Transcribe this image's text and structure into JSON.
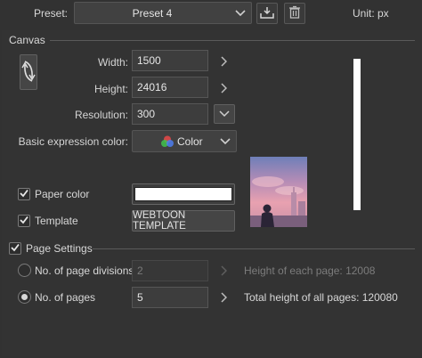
{
  "top": {
    "preset_label": "Preset:",
    "preset_value": "Preset 4",
    "unit_label": "Unit: px"
  },
  "canvas": {
    "section_title": "Canvas",
    "width_label": "Width:",
    "width_value": "1500",
    "height_label": "Height:",
    "height_value": "24016",
    "resolution_label": "Resolution:",
    "resolution_value": "300",
    "color_label": "Basic expression color:",
    "color_value": "Color",
    "paper_color_label": "Paper color",
    "paper_color_checked": true,
    "paper_color_swatch": "#ffffff",
    "template_label": "Template",
    "template_checked": true,
    "template_value": "WEBTOON TEMPLATE"
  },
  "page_settings": {
    "section_title": "Page Settings",
    "checked": true,
    "divisions_label": "No. of page divisions",
    "divisions_value": "2",
    "height_each_text": "Height of each page: 12008",
    "pages_label": "No. of pages",
    "pages_value": "5",
    "total_height_text": "Total height of all pages: 120080",
    "selected_option": "No. of pages"
  },
  "icons": {
    "preset_chevron": "chevron-down-icon",
    "register_preset": "register-preset-icon",
    "delete_preset": "trash-icon",
    "swap": "swap-orientation-icon",
    "color_mode": "rgb-circles-icon"
  }
}
